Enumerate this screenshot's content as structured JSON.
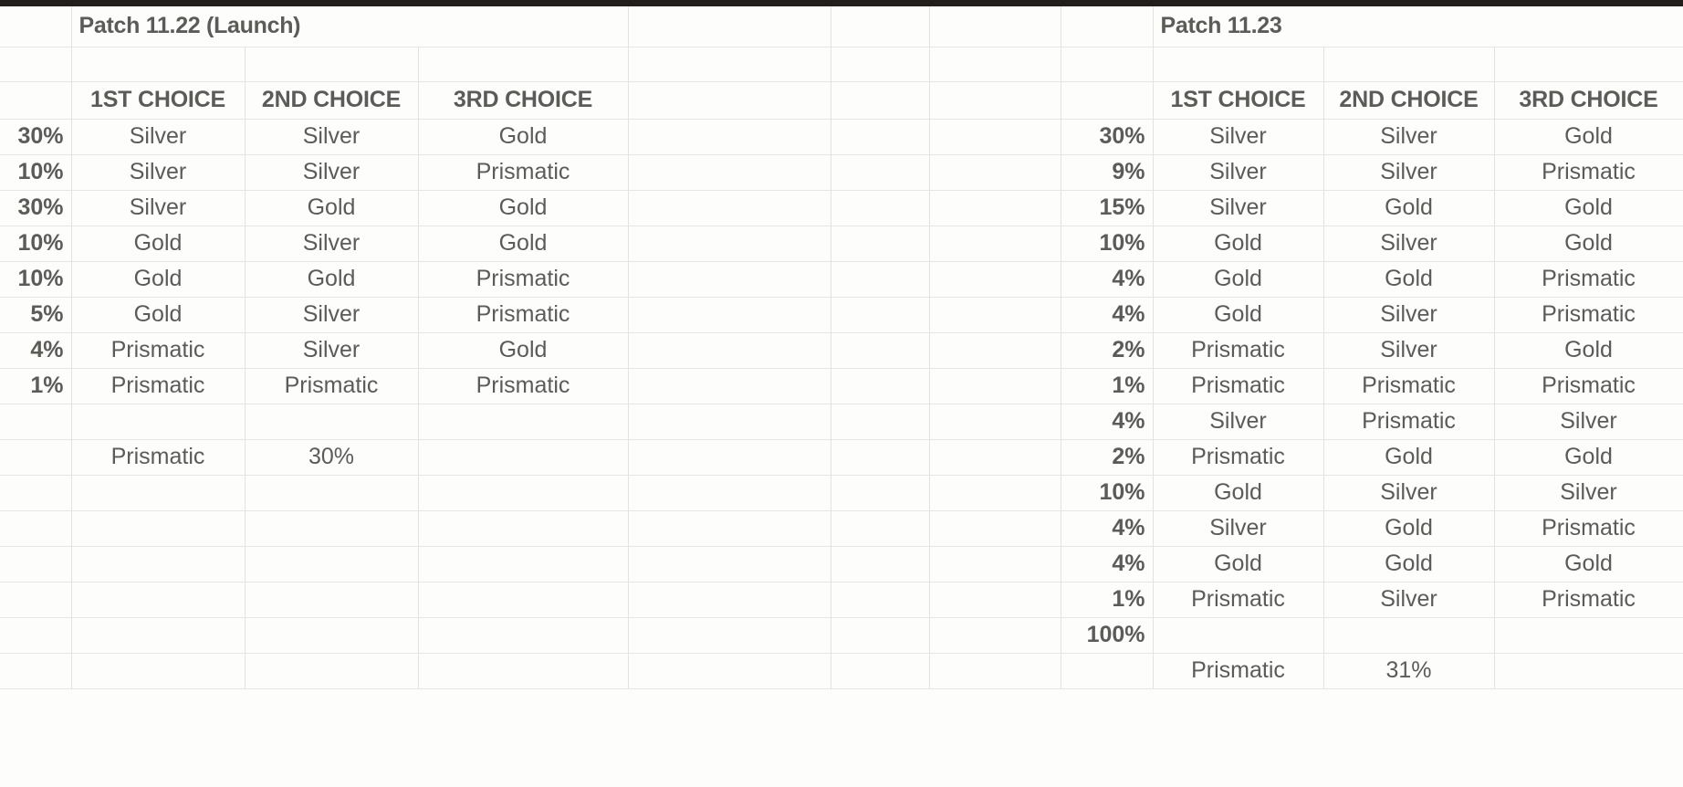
{
  "sheet": {
    "left_table": {
      "title": "Patch 11.22 (Launch)",
      "columns": [
        "1ST CHOICE",
        "2ND CHOICE",
        "3RD CHOICE"
      ],
      "rows": [
        {
          "pct": "30%",
          "c1": "Silver",
          "c2": "Silver",
          "c3": "Gold"
        },
        {
          "pct": "10%",
          "c1": "Silver",
          "c2": "Silver",
          "c3": "Prismatic"
        },
        {
          "pct": "30%",
          "c1": "Silver",
          "c2": "Gold",
          "c3": "Gold"
        },
        {
          "pct": "10%",
          "c1": "Gold",
          "c2": "Silver",
          "c3": "Gold"
        },
        {
          "pct": "10%",
          "c1": "Gold",
          "c2": "Gold",
          "c3": "Prismatic"
        },
        {
          "pct": "5%",
          "c1": "Gold",
          "c2": "Silver",
          "c3": "Prismatic"
        },
        {
          "pct": "4%",
          "c1": "Prismatic",
          "c2": "Silver",
          "c3": "Gold"
        },
        {
          "pct": "1%",
          "c1": "Prismatic",
          "c2": "Prismatic",
          "c3": "Prismatic"
        }
      ],
      "summary": {
        "label": "Prismatic",
        "value": "30%"
      }
    },
    "right_table": {
      "title": "Patch 11.23",
      "columns": [
        "1ST CHOICE",
        "2ND CHOICE",
        "3RD CHOICE"
      ],
      "rows": [
        {
          "pct": "30%",
          "c1": "Silver",
          "c2": "Silver",
          "c3": "Gold"
        },
        {
          "pct": "9%",
          "c1": "Silver",
          "c2": "Silver",
          "c3": "Prismatic"
        },
        {
          "pct": "15%",
          "c1": "Silver",
          "c2": "Gold",
          "c3": "Gold"
        },
        {
          "pct": "10%",
          "c1": "Gold",
          "c2": "Silver",
          "c3": "Gold"
        },
        {
          "pct": "4%",
          "c1": "Gold",
          "c2": "Gold",
          "c3": "Prismatic"
        },
        {
          "pct": "4%",
          "c1": "Gold",
          "c2": "Silver",
          "c3": "Prismatic"
        },
        {
          "pct": "2%",
          "c1": "Prismatic",
          "c2": "Silver",
          "c3": "Gold"
        },
        {
          "pct": "1%",
          "c1": "Prismatic",
          "c2": "Prismatic",
          "c3": "Prismatic"
        },
        {
          "pct": "4%",
          "c1": "Silver",
          "c2": "Prismatic",
          "c3": "Silver"
        },
        {
          "pct": "2%",
          "c1": "Prismatic",
          "c2": "Gold",
          "c3": "Gold"
        },
        {
          "pct": "10%",
          "c1": "Gold",
          "c2": "Silver",
          "c3": "Silver"
        },
        {
          "pct": "4%",
          "c1": "Silver",
          "c2": "Gold",
          "c3": "Prismatic"
        },
        {
          "pct": "4%",
          "c1": "Gold",
          "c2": "Gold",
          "c3": "Gold"
        },
        {
          "pct": "1%",
          "c1": "Prismatic",
          "c2": "Silver",
          "c3": "Prismatic"
        },
        {
          "pct": "100%",
          "c1": "",
          "c2": "",
          "c3": ""
        }
      ],
      "summary": {
        "label": "Prismatic",
        "value": "31%"
      }
    }
  }
}
